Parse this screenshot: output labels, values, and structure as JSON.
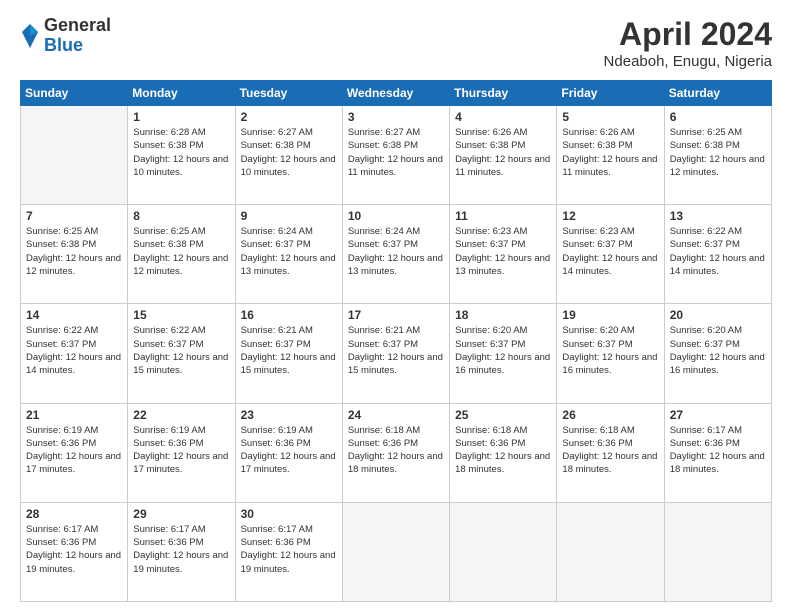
{
  "header": {
    "logo_general": "General",
    "logo_blue": "Blue",
    "month_title": "April 2024",
    "location": "Ndeaboh, Enugu, Nigeria"
  },
  "days_of_week": [
    "Sunday",
    "Monday",
    "Tuesday",
    "Wednesday",
    "Thursday",
    "Friday",
    "Saturday"
  ],
  "weeks": [
    [
      {
        "day": "",
        "empty": true
      },
      {
        "day": "1",
        "sunrise": "6:28 AM",
        "sunset": "6:38 PM",
        "daylight": "12 hours and 10 minutes."
      },
      {
        "day": "2",
        "sunrise": "6:27 AM",
        "sunset": "6:38 PM",
        "daylight": "12 hours and 10 minutes."
      },
      {
        "day": "3",
        "sunrise": "6:27 AM",
        "sunset": "6:38 PM",
        "daylight": "12 hours and 11 minutes."
      },
      {
        "day": "4",
        "sunrise": "6:26 AM",
        "sunset": "6:38 PM",
        "daylight": "12 hours and 11 minutes."
      },
      {
        "day": "5",
        "sunrise": "6:26 AM",
        "sunset": "6:38 PM",
        "daylight": "12 hours and 11 minutes."
      },
      {
        "day": "6",
        "sunrise": "6:25 AM",
        "sunset": "6:38 PM",
        "daylight": "12 hours and 12 minutes."
      }
    ],
    [
      {
        "day": "7",
        "sunrise": "6:25 AM",
        "sunset": "6:38 PM",
        "daylight": "12 hours and 12 minutes."
      },
      {
        "day": "8",
        "sunrise": "6:25 AM",
        "sunset": "6:38 PM",
        "daylight": "12 hours and 12 minutes."
      },
      {
        "day": "9",
        "sunrise": "6:24 AM",
        "sunset": "6:37 PM",
        "daylight": "12 hours and 13 minutes."
      },
      {
        "day": "10",
        "sunrise": "6:24 AM",
        "sunset": "6:37 PM",
        "daylight": "12 hours and 13 minutes."
      },
      {
        "day": "11",
        "sunrise": "6:23 AM",
        "sunset": "6:37 PM",
        "daylight": "12 hours and 13 minutes."
      },
      {
        "day": "12",
        "sunrise": "6:23 AM",
        "sunset": "6:37 PM",
        "daylight": "12 hours and 14 minutes."
      },
      {
        "day": "13",
        "sunrise": "6:22 AM",
        "sunset": "6:37 PM",
        "daylight": "12 hours and 14 minutes."
      }
    ],
    [
      {
        "day": "14",
        "sunrise": "6:22 AM",
        "sunset": "6:37 PM",
        "daylight": "12 hours and 14 minutes."
      },
      {
        "day": "15",
        "sunrise": "6:22 AM",
        "sunset": "6:37 PM",
        "daylight": "12 hours and 15 minutes."
      },
      {
        "day": "16",
        "sunrise": "6:21 AM",
        "sunset": "6:37 PM",
        "daylight": "12 hours and 15 minutes."
      },
      {
        "day": "17",
        "sunrise": "6:21 AM",
        "sunset": "6:37 PM",
        "daylight": "12 hours and 15 minutes."
      },
      {
        "day": "18",
        "sunrise": "6:20 AM",
        "sunset": "6:37 PM",
        "daylight": "12 hours and 16 minutes."
      },
      {
        "day": "19",
        "sunrise": "6:20 AM",
        "sunset": "6:37 PM",
        "daylight": "12 hours and 16 minutes."
      },
      {
        "day": "20",
        "sunrise": "6:20 AM",
        "sunset": "6:37 PM",
        "daylight": "12 hours and 16 minutes."
      }
    ],
    [
      {
        "day": "21",
        "sunrise": "6:19 AM",
        "sunset": "6:36 PM",
        "daylight": "12 hours and 17 minutes."
      },
      {
        "day": "22",
        "sunrise": "6:19 AM",
        "sunset": "6:36 PM",
        "daylight": "12 hours and 17 minutes."
      },
      {
        "day": "23",
        "sunrise": "6:19 AM",
        "sunset": "6:36 PM",
        "daylight": "12 hours and 17 minutes."
      },
      {
        "day": "24",
        "sunrise": "6:18 AM",
        "sunset": "6:36 PM",
        "daylight": "12 hours and 18 minutes."
      },
      {
        "day": "25",
        "sunrise": "6:18 AM",
        "sunset": "6:36 PM",
        "daylight": "12 hours and 18 minutes."
      },
      {
        "day": "26",
        "sunrise": "6:18 AM",
        "sunset": "6:36 PM",
        "daylight": "12 hours and 18 minutes."
      },
      {
        "day": "27",
        "sunrise": "6:17 AM",
        "sunset": "6:36 PM",
        "daylight": "12 hours and 18 minutes."
      }
    ],
    [
      {
        "day": "28",
        "sunrise": "6:17 AM",
        "sunset": "6:36 PM",
        "daylight": "12 hours and 19 minutes."
      },
      {
        "day": "29",
        "sunrise": "6:17 AM",
        "sunset": "6:36 PM",
        "daylight": "12 hours and 19 minutes."
      },
      {
        "day": "30",
        "sunrise": "6:17 AM",
        "sunset": "6:36 PM",
        "daylight": "12 hours and 19 minutes."
      },
      {
        "day": "",
        "empty": true
      },
      {
        "day": "",
        "empty": true
      },
      {
        "day": "",
        "empty": true
      },
      {
        "day": "",
        "empty": true
      }
    ]
  ],
  "labels": {
    "sunrise_prefix": "Sunrise: ",
    "sunset_prefix": "Sunset: ",
    "daylight_prefix": "Daylight: "
  }
}
